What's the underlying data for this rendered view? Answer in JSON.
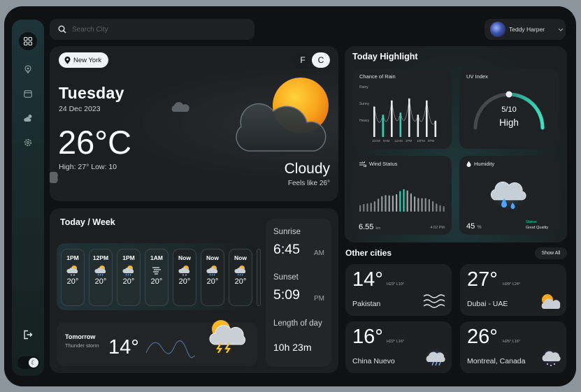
{
  "search": {
    "placeholder": "Search City"
  },
  "user": {
    "name": "Teddy Harper"
  },
  "sidebar": {
    "items": [
      {
        "name": "dashboard-icon",
        "glyph": "▦"
      },
      {
        "name": "location-icon",
        "glyph": "◎"
      },
      {
        "name": "calendar-icon",
        "glyph": "▭"
      },
      {
        "name": "weather-icon",
        "glyph": "☁"
      },
      {
        "name": "settings-icon",
        "glyph": "⚙"
      }
    ],
    "logout_icon": "logout-icon",
    "theme_toggle_glyph": "☾"
  },
  "current": {
    "location": "New York",
    "unit_f": "F",
    "unit_c": "C",
    "day": "Tuesday",
    "date": "24 Dec 2023",
    "temp": "26°C",
    "hilo": "High: 27° Low: 10",
    "condition": "Cloudy",
    "feels_like": "Feels like 26°"
  },
  "week": {
    "title": "Today /  Week",
    "hours": [
      {
        "label": "1PM",
        "temp": "20°",
        "icon": "snow-cloud-icon"
      },
      {
        "label": "12PM",
        "temp": "20°",
        "icon": "rain-cloud-icon"
      },
      {
        "label": "1PM",
        "temp": "20°",
        "icon": "rain-cloud-icon"
      },
      {
        "label": "1AM",
        "temp": "20°",
        "icon": "wind-icon"
      },
      {
        "label": "Now",
        "temp": "20°",
        "icon": "snow-cloud-icon"
      },
      {
        "label": "Now",
        "temp": "20°",
        "icon": "rain-cloud-icon"
      },
      {
        "label": "Now",
        "temp": "20°",
        "icon": "rain-cloud-icon"
      }
    ],
    "tomorrow": {
      "label": "Tomorrow",
      "condition": "Thunder storm",
      "temp": "14°"
    },
    "sunrise": {
      "label": "Sunrise",
      "time": "6:45",
      "ampm": "AM"
    },
    "sunset": {
      "label": "Sunset",
      "time": "5:09",
      "ampm": "PM"
    },
    "daylength": {
      "label": "Length of day",
      "value": "10h 23m"
    }
  },
  "highlight": {
    "title": "Today Highlight",
    "rain": {
      "title": "Chance of  Rain",
      "levels": [
        "Rainy",
        "Sunny",
        "Heavy"
      ],
      "times": [
        "10AM",
        "8AM",
        "12AM",
        "2PM",
        "10PM",
        "8PM"
      ],
      "bars": [
        {
          "value": 0.75,
          "accent": false
        },
        {
          "value": 0.55,
          "accent": true
        },
        {
          "value": 0.9,
          "accent": false
        },
        {
          "value": 0.6,
          "accent": true
        },
        {
          "value": 0.95,
          "accent": false
        },
        {
          "value": 0.55,
          "accent": false
        },
        {
          "value": 0.9,
          "accent": false
        },
        {
          "value": 0.4,
          "accent": false
        }
      ]
    },
    "uv": {
      "title": "UV Index",
      "value": "5/10",
      "level": "High",
      "fraction": 0.5
    },
    "wind": {
      "title": "Wind Status",
      "speed": "6.55",
      "unit": "km",
      "time": "4:02 PM"
    },
    "humidity": {
      "title": "Humidity",
      "value": "45",
      "unit": "%",
      "status_label": "Status",
      "status": "Good Quality"
    }
  },
  "cities": {
    "title": "Other cities",
    "show_all": "Show All",
    "items": [
      {
        "temp": "14°",
        "hilo": "H23° L10°",
        "name": "Pakistan",
        "icon": "wind-icon"
      },
      {
        "temp": "27°",
        "hilo": "H29° L24°",
        "name": "Dubai - UAE",
        "icon": "sun-cloud-icon"
      },
      {
        "temp": "16°",
        "hilo": "H22° L16°",
        "name": "China Nuevo",
        "icon": "storm-cloud-icon"
      },
      {
        "temp": "26°",
        "hilo": "H25° L16°",
        "name": "Montreal, Canada",
        "icon": "snow-cloud-icon"
      }
    ]
  },
  "colors": {
    "accent": "#2fd1b4",
    "sun": "#f7a81b",
    "background": "#101113",
    "card": "#1c1e20"
  }
}
